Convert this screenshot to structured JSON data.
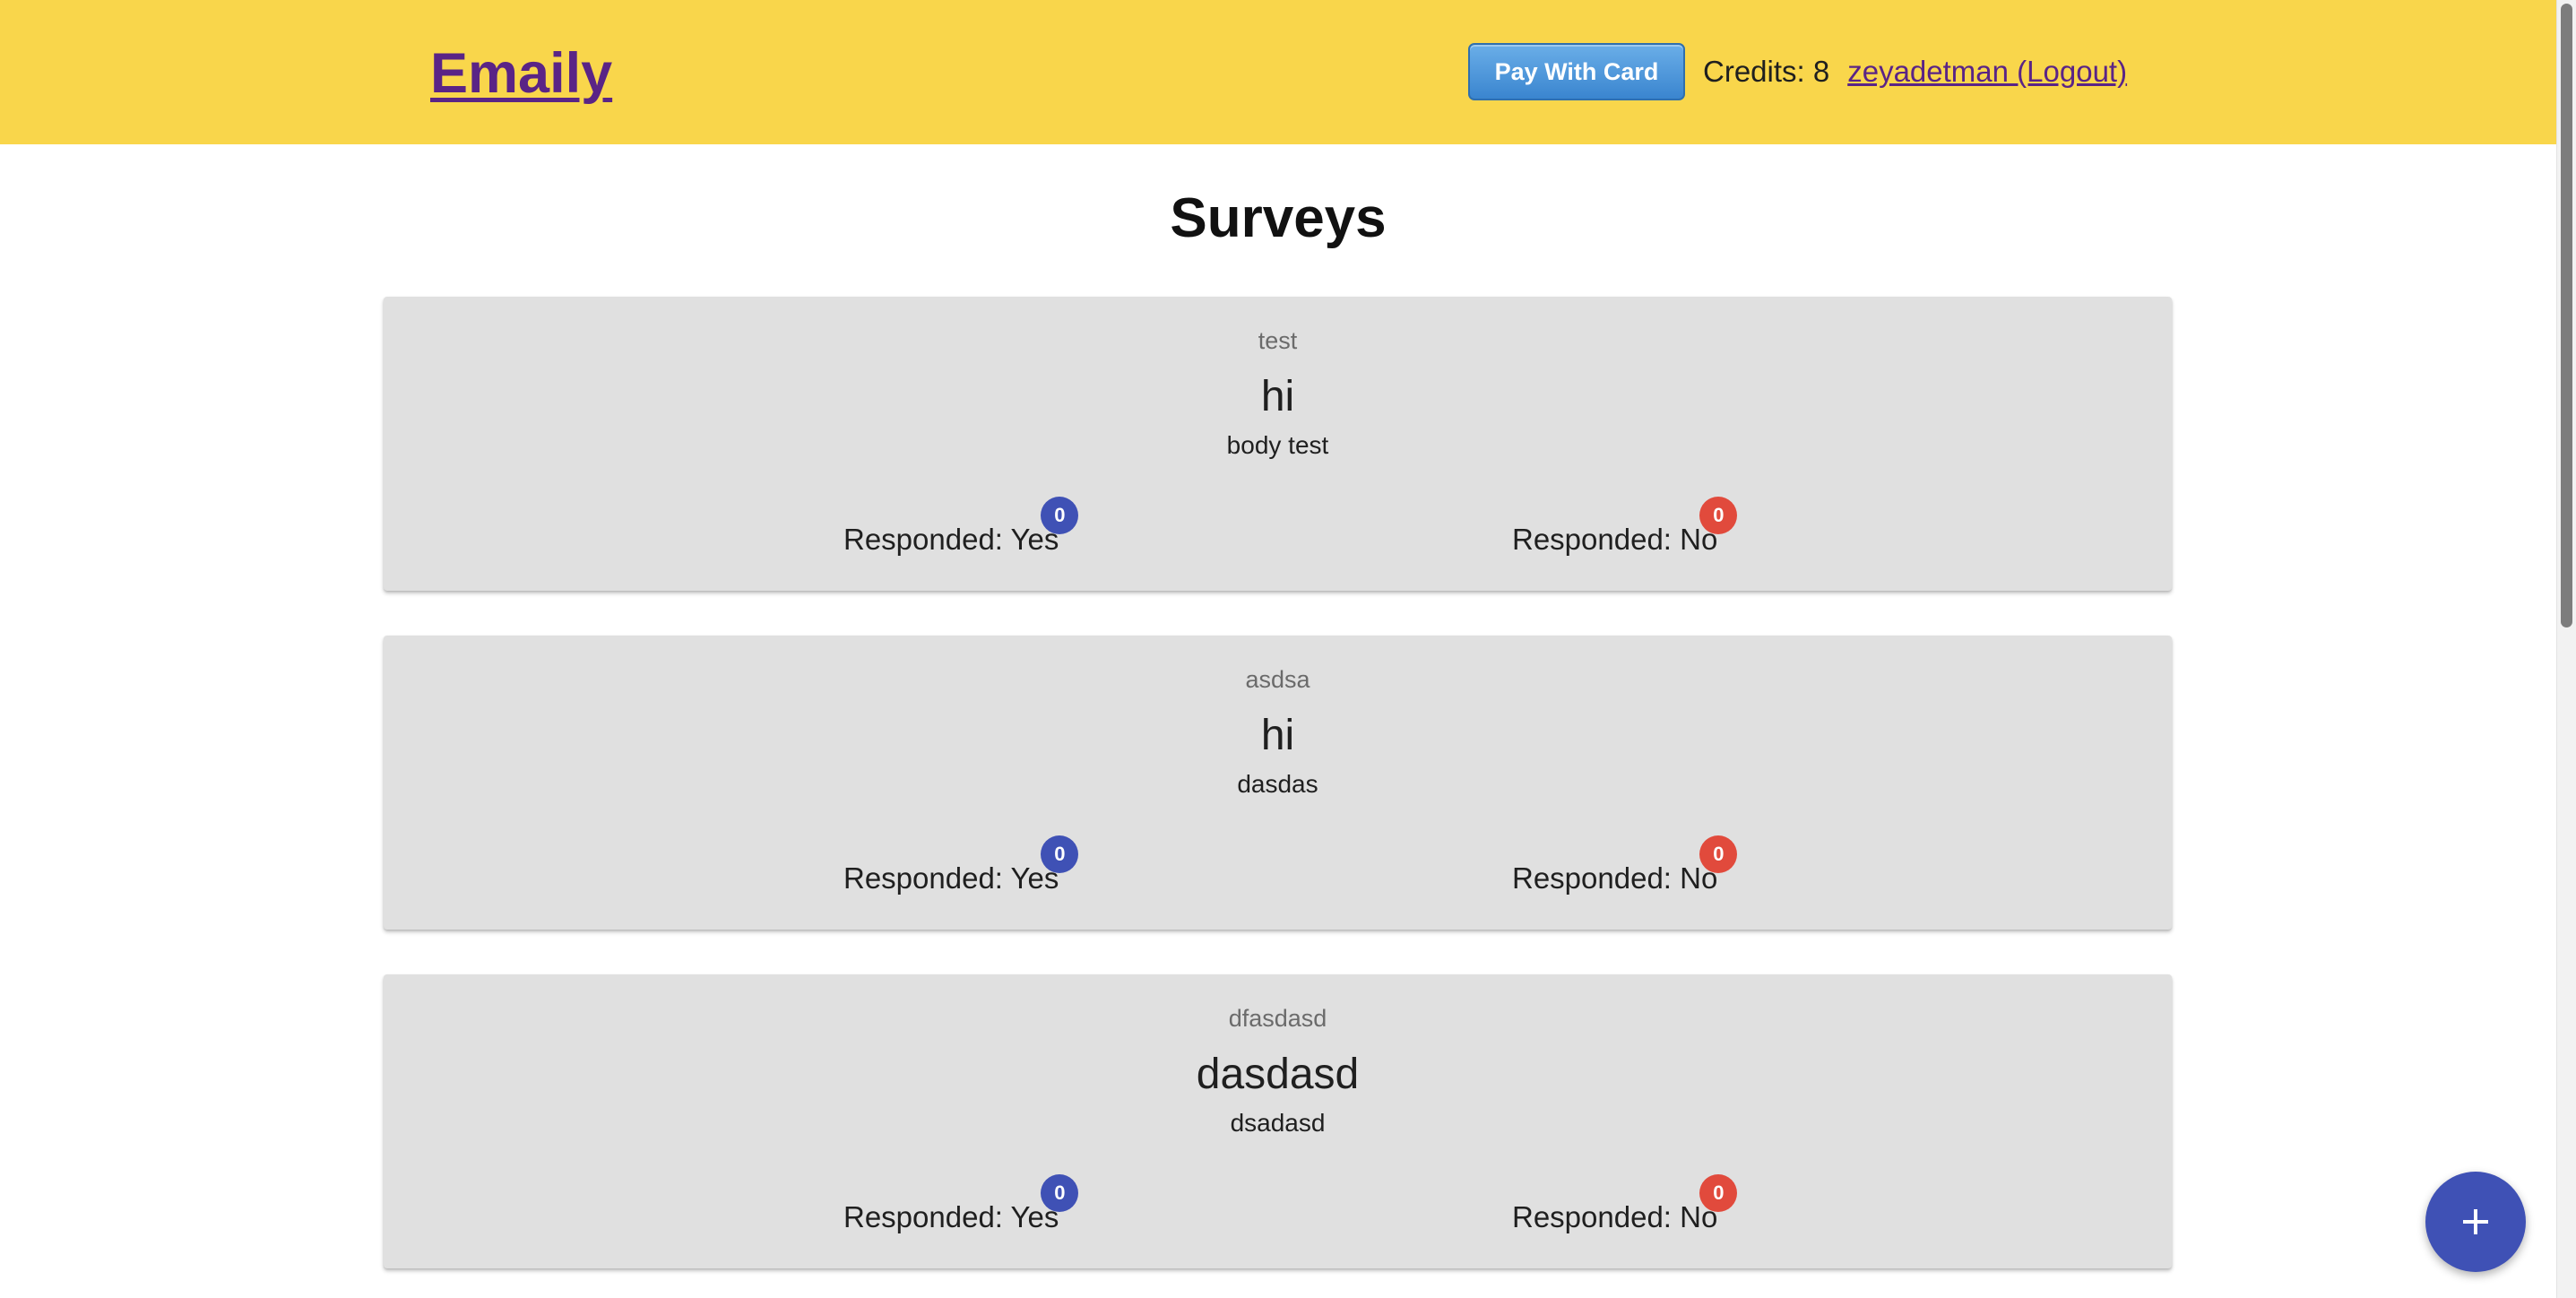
{
  "navbar": {
    "brand": "Emaily",
    "pay_button": "Pay With Card",
    "credits": "Credits: 8",
    "user_link": "zeyadetman (Logout)"
  },
  "page": {
    "title": "Surveys"
  },
  "surveys": [
    {
      "subject": "test",
      "title": "hi",
      "body": "body test",
      "yes_label": "Responded: Yes",
      "yes_count": "0",
      "no_label": "Responded: No",
      "no_count": "0"
    },
    {
      "subject": "asdsa",
      "title": "hi",
      "body": "dasdas",
      "yes_label": "Responded: Yes",
      "yes_count": "0",
      "no_label": "Responded: No",
      "no_count": "0"
    },
    {
      "subject": "dfasdasd",
      "title": "dasdasd",
      "body": "dsadasd",
      "yes_label": "Responded: Yes",
      "yes_count": "0",
      "no_label": "Responded: No",
      "no_count": "0"
    }
  ],
  "fab": {
    "icon": "plus-icon"
  },
  "colors": {
    "navbar_bg": "#f9d64b",
    "brand": "#5a2486",
    "card_bg": "#e0e0e0",
    "badge_yes": "#3f51b5",
    "badge_no": "#e14a3c",
    "fab": "#3f51b5"
  }
}
